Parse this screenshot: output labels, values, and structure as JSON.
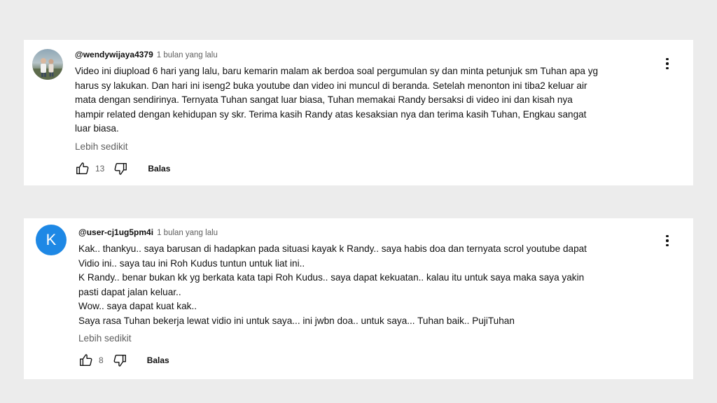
{
  "comments": [
    {
      "handle": "@wendywijaya4379",
      "time": "1 bulan yang lalu",
      "avatar_type": "photo",
      "lines": [
        "Video ini diupload 6 hari yang lalu, baru kemarin malam ak berdoa soal pergumulan sy dan minta petunjuk sm Tuhan apa yg",
        "harus sy lakukan. Dan hari ini iseng2 buka youtube dan video ini muncul di beranda. Setelah menonton ini tiba2 keluar air",
        "mata dengan sendirinya. Ternyata Tuhan sangat luar biasa, Tuhan memakai Randy bersaksi di video ini  dan kisah nya",
        "hampir related dengan kehidupan sy skr. Terima kasih Randy atas kesaksian nya dan terima kasih Tuhan, Engkau sangat",
        "luar biasa."
      ],
      "less_label": "Lebih sedikit",
      "likes": "13",
      "reply_label": "Balas"
    },
    {
      "handle": "@user-cj1ug5pm4i",
      "time": "1 bulan yang lalu",
      "avatar_type": "letter",
      "avatar_letter": "K",
      "avatar_color": "#1e88e5",
      "lines": [
        "Kak.. thankyu.. saya barusan di hadapkan pada situasi kayak k Randy.. saya habis doa dan ternyata scrol youtube dapat",
        "Vidio ini.. saya tau ini Roh Kudus tuntun untuk liat ini..",
        "K Randy.. benar bukan kk yg berkata kata tapi Roh Kudus.. saya dapat kekuatan.. kalau itu untuk saya maka saya yakin",
        "pasti dapat jalan keluar..",
        "Wow.. saya dapat kuat kak..",
        "Saya rasa Tuhan bekerja lewat vidio ini untuk saya... ini jwbn doa.. untuk saya... Tuhan baik.. PujiTuhan"
      ],
      "less_label": "Lebih sedikit",
      "likes": "8",
      "reply_label": "Balas"
    }
  ],
  "icons": {
    "like": "thumb-up-icon",
    "dislike": "thumb-down-icon",
    "menu": "more-vert-icon"
  }
}
